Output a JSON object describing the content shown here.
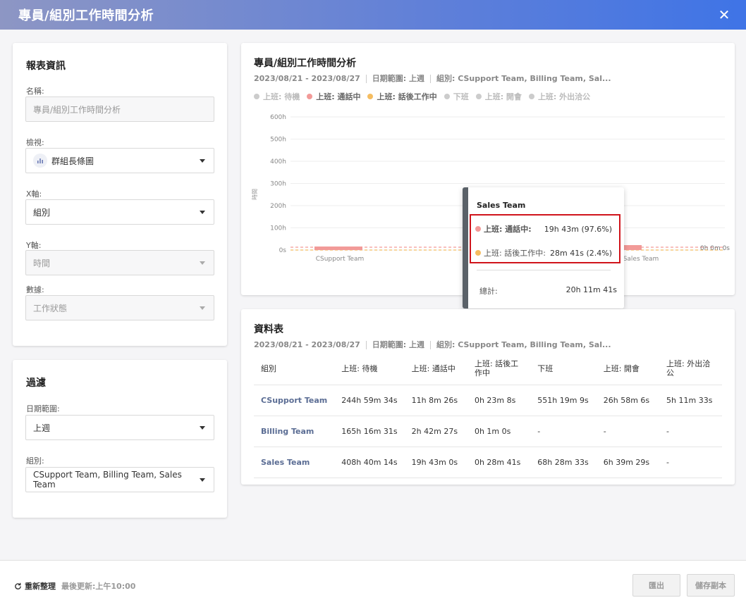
{
  "header": {
    "title": "專員/組別工作時間分析",
    "close": "✕"
  },
  "report_info": {
    "title": "報表資訊",
    "name_label": "名稱:",
    "name_value": "專員/組別工作時間分析",
    "view_label": "檢視:",
    "view_value": "群組長條圖",
    "x_label": "X軸:",
    "x_value": "組別",
    "y_label": "Y軸:",
    "y_value": "時間",
    "data_label": "數據:",
    "data_value": "工作狀態"
  },
  "filter": {
    "title": "過濾",
    "date_label": "日期範圍:",
    "date_value": "上週",
    "group_label": "組別:",
    "group_value": "CSupport Team, Billing Team, Sales Team"
  },
  "chart_panel": {
    "title": "專員/組別工作時間分析",
    "date": "2023/08/21 - 2023/08/27",
    "range": "日期範圍: 上週",
    "groups": "組別: CSupport Team, Billing Team, Sal...",
    "legend": [
      "上班: 待機",
      "上班: 通話中",
      "上班: 話後工作中",
      "下班",
      "上班: 開會",
      "上班: 外出洽公"
    ],
    "end_label": "0h 0m 0s"
  },
  "chart_data": {
    "type": "bar",
    "ylabel": "時間",
    "yticks": [
      "600h",
      "500h",
      "400h",
      "300h",
      "200h",
      "100h",
      "0s"
    ],
    "categories": [
      "CSupport Team",
      "Sales Team"
    ],
    "colors": {
      "上班: 待機": "#cccccc",
      "上班: 通話中": "#f29a98",
      "上班: 話後工作中": "#f5bd61",
      "下班": "#cccccc",
      "上班: 開會": "#cccccc",
      "上班: 外出洽公": "#cccccc"
    }
  },
  "tooltip": {
    "title": "Sales Team",
    "rows": [
      {
        "label": "上班: 通話中:",
        "value": "19h 43m (97.6%)",
        "color": "#f29a98"
      },
      {
        "label": "上班: 話後工作中:",
        "value": "28m 41s (2.4%)",
        "color": "#f5bd61"
      }
    ],
    "total_label": "總計:",
    "total_value": "20h 11m 41s"
  },
  "table_panel": {
    "title": "資料表",
    "date": "2023/08/21 - 2023/08/27",
    "range": "日期範圍: 上週",
    "groups": "組別: CSupport Team, Billing Team, Sal...",
    "headers": [
      "組別",
      "上班: 待機",
      "上班: 通話中",
      "上班: 話後工作中",
      "下班",
      "上班: 開會",
      "上班: 外出洽公"
    ],
    "rows": [
      [
        "CSupport Team",
        "244h 59m 34s",
        "11h 8m 26s",
        "0h 23m 8s",
        "551h 19m 9s",
        "26h 58m 6s",
        "5h 11m 33s"
      ],
      [
        "Billing Team",
        "165h 16m 31s",
        "2h 42m 27s",
        "0h 1m 0s",
        "-",
        "-",
        "-"
      ],
      [
        "Sales Team",
        "408h 40m 14s",
        "19h 43m 0s",
        "0h 28m 41s",
        "68h 28m 33s",
        "6h 39m 29s",
        "-"
      ]
    ]
  },
  "footer": {
    "refresh": "重新整理",
    "updated": "最後更新:上午10:00",
    "export": "匯出",
    "save_copy": "儲存副本"
  }
}
